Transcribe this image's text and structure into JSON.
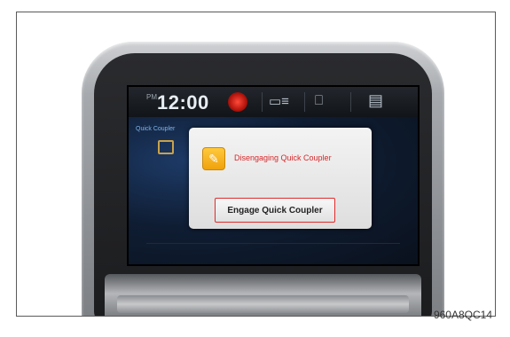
{
  "statusbar": {
    "time_period": "PM",
    "time": "12:00",
    "icons": [
      "alert-icon",
      "camera-menu-icon",
      "phone-icon",
      "clipboard-icon"
    ]
  },
  "panel": {
    "tab_label": "Quick Coupler"
  },
  "dialog": {
    "icon": "quick-coupler-icon",
    "message": "Disengaging Quick Coupler",
    "button_label": "Engage Quick Coupler"
  },
  "figure_ref": "960A8QC14",
  "colors": {
    "message": "#d7282a",
    "button_outline": "#e02a2a",
    "icon_bg": "#f0a20c"
  }
}
